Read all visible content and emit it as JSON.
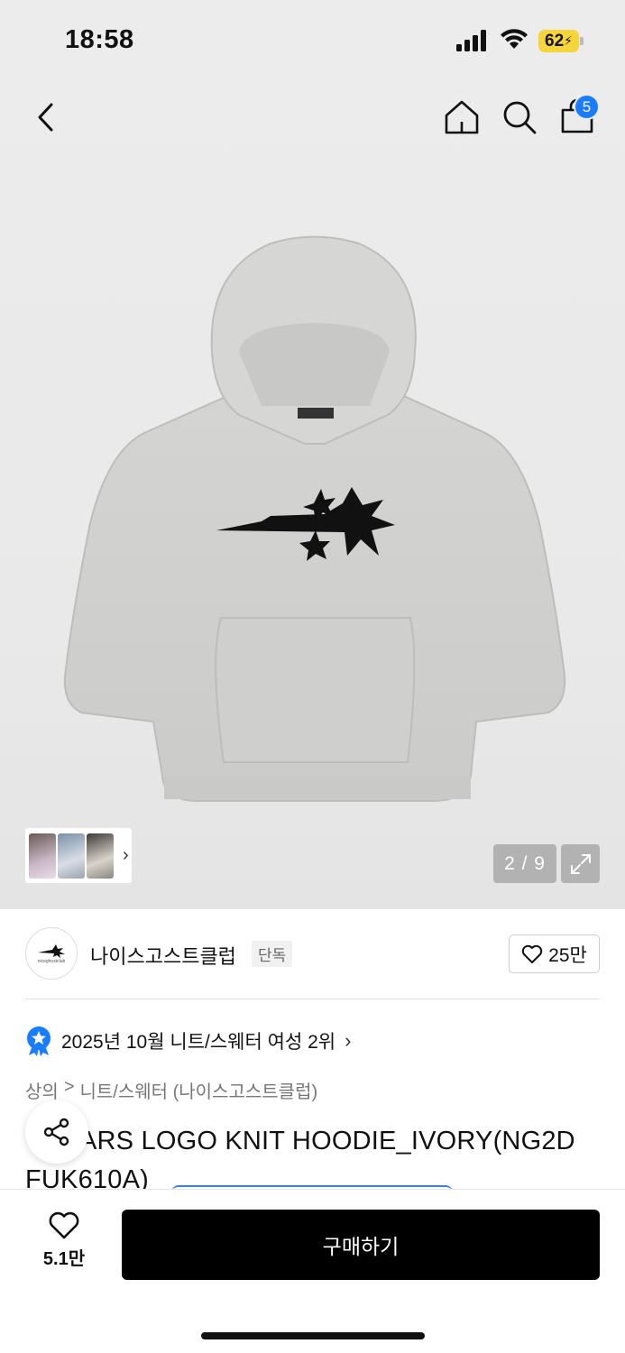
{
  "status_bar": {
    "time": "18:58",
    "battery": "62"
  },
  "header": {
    "cart_count": "5"
  },
  "gallery": {
    "counter": "2 / 9"
  },
  "brand": {
    "name": "나이스고스트클럽",
    "tag": "단독",
    "likes": "25만"
  },
  "ranking": {
    "text": "2025년 10월 니트/스웨터 여성 2위"
  },
  "breadcrumb": {
    "level1": "상의",
    "separator": ">",
    "level2": "니트/스웨터 (나이스고스트클럽)"
  },
  "product": {
    "title": "STARS LOGO KNIT HOODIE_IVORY(NG2DFUK610A)",
    "title_visible": "ARS LOGO KNIT HOODIE_IVORY(NG2D FUK610A)"
  },
  "bottom": {
    "wish_count": "5.1만",
    "buy_label": "구매하기"
  },
  "colors": {
    "accent": "#1a7cff",
    "buy_bg": "#000000",
    "battery": "#f6d53a"
  }
}
